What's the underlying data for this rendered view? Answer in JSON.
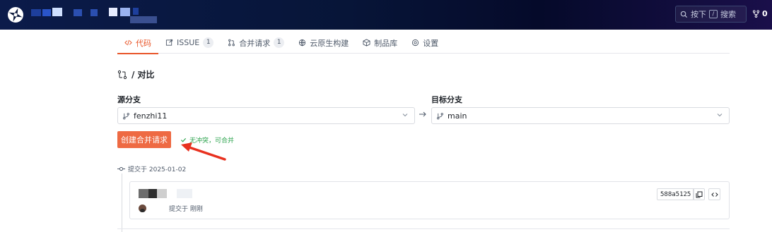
{
  "header": {
    "search_label": "搜索",
    "search_shortcut": "按下",
    "search_key": "/",
    "fork_count": "0"
  },
  "tabs": [
    {
      "label": "代码",
      "icon": "code-icon",
      "active": true
    },
    {
      "label": "ISSUE",
      "icon": "issue-icon",
      "badge": "1"
    },
    {
      "label": "合并请求",
      "icon": "pull-request-icon",
      "badge": "1"
    },
    {
      "label": "云原生构建",
      "icon": "cloud-build-icon"
    },
    {
      "label": "制品库",
      "icon": "package-icon"
    },
    {
      "label": "设置",
      "icon": "settings-icon"
    }
  ],
  "breadcrumb": {
    "title": "/ 对比"
  },
  "compare": {
    "source_label": "源分支",
    "source_branch": "fenzhi11",
    "target_label": "目标分支",
    "target_branch": "main"
  },
  "actions": {
    "create_mr_label": "创建合并请求",
    "status_text": "无冲突，可合并"
  },
  "commits": {
    "group_label": "提交于 2025-01-02",
    "items": [
      {
        "sha": "588a5125",
        "meta": "提交于 刚刚"
      }
    ]
  },
  "colors": {
    "accent": "#ee6a43",
    "success": "#2ea44f",
    "header_bg": "#071538"
  }
}
